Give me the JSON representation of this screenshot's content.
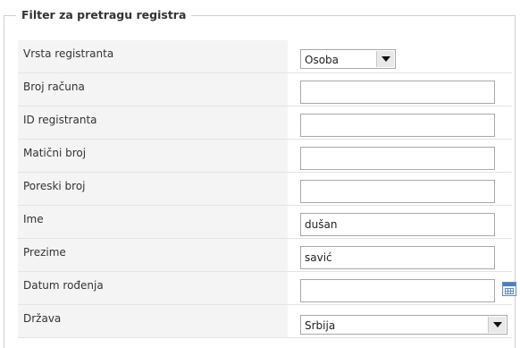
{
  "filter": {
    "legend": "Filter za pretragu registra",
    "fields": {
      "vrsta": {
        "label": "Vrsta registranta",
        "value": "Osoba"
      },
      "broj_racuna": {
        "label": "Broj računa",
        "value": ""
      },
      "id_registranta": {
        "label": "ID registranta",
        "value": ""
      },
      "maticni_broj": {
        "label": "Matični broj",
        "value": ""
      },
      "poreski_broj": {
        "label": "Poreski broj",
        "value": ""
      },
      "ime": {
        "label": "Ime",
        "value": "dušan"
      },
      "prezime": {
        "label": "Prezime",
        "value": "savić"
      },
      "datum_rodjenja": {
        "label": "Datum rođenja",
        "value": "",
        "icon": "calendar-icon"
      },
      "drzava": {
        "label": "Država",
        "value": "Srbija"
      }
    }
  },
  "colors": {
    "label_bg": "#f4f4f4",
    "row_border": "#e3e3e3",
    "input_border": "#a9a9a9"
  }
}
